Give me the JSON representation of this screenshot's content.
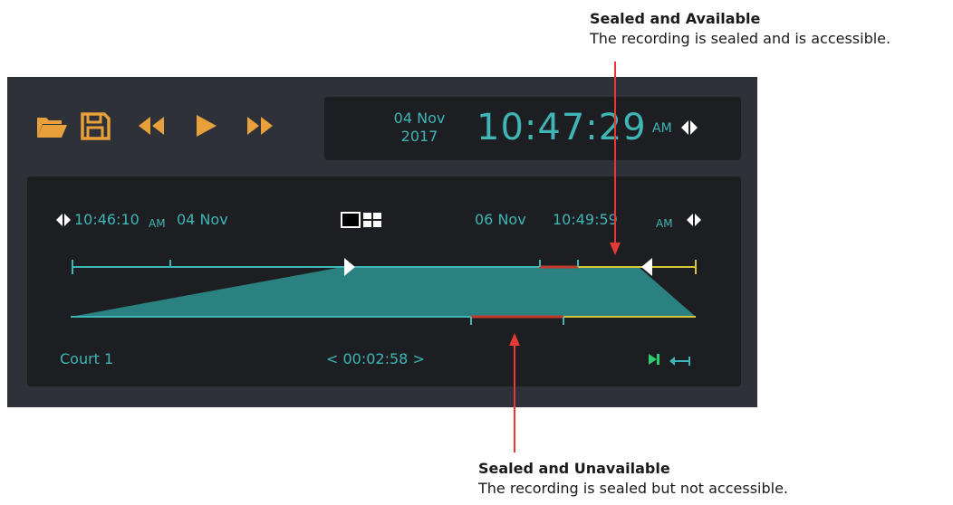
{
  "callouts": {
    "top": {
      "title": "Sealed and Available",
      "description": "The recording is sealed and is accessible."
    },
    "bottom": {
      "title": "Sealed and Unavailable",
      "description": "The recording is sealed but not accessible."
    }
  },
  "toolbar": {
    "icons": [
      "folder-open-icon",
      "save-icon",
      "rewind-icon",
      "play-icon",
      "fast-forward-icon"
    ]
  },
  "clock": {
    "date_day": "04 Nov",
    "date_year": "2017",
    "time": "10:47:29",
    "ampm": "AM"
  },
  "timeline": {
    "start_time": "10:46:10",
    "start_ampm": "AM",
    "start_date": "04 Nov",
    "end_date": "06 Nov",
    "end_time": "10:49:59",
    "end_ampm": "AM",
    "channel": "Court 1",
    "duration": "< 00:02:58 >"
  },
  "colors": {
    "accent": "#3fb5b6",
    "toolbar_icon": "#e8a13a",
    "sealed_available": "#d4c53a",
    "sealed_unavailable": "#c0392b",
    "callout_arrow": "#e53935",
    "panel_bg": "#1c1e22",
    "player_bg": "#2e3138"
  }
}
